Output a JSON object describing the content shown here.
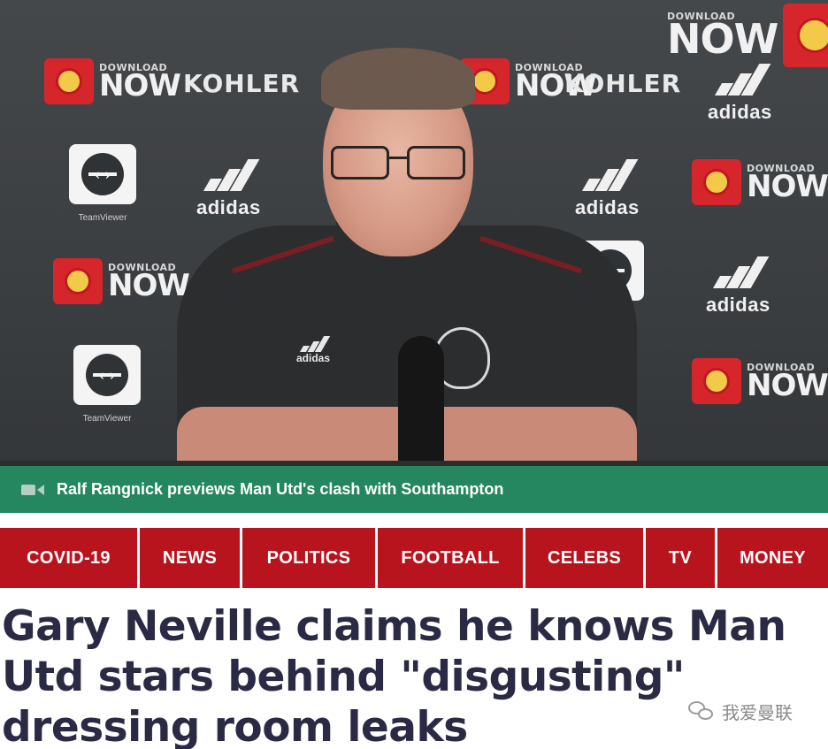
{
  "video": {
    "caption": "Ralf Rangnick previews Man Utd's clash with Southampton",
    "backdrop": {
      "download_small": "DOWNLOAD",
      "download_big": "NOW",
      "kohler": "KOHLER",
      "adidas": "adidas",
      "teamviewer": "TeamViewer"
    }
  },
  "nav": {
    "items": [
      {
        "label": "COVID-19"
      },
      {
        "label": "NEWS"
      },
      {
        "label": "POLITICS"
      },
      {
        "label": "FOOTBALL"
      },
      {
        "label": "CELEBS"
      },
      {
        "label": "TV"
      },
      {
        "label": "MONEY"
      }
    ]
  },
  "article": {
    "headline": "Gary Neville claims he knows Man Utd stars behind \"disgusting\" dressing room leaks"
  },
  "watermark": {
    "text": "我爱曼联"
  },
  "colors": {
    "nav_red": "#b8141e",
    "caption_green": "#24875f",
    "headline": "#2a2a44"
  }
}
